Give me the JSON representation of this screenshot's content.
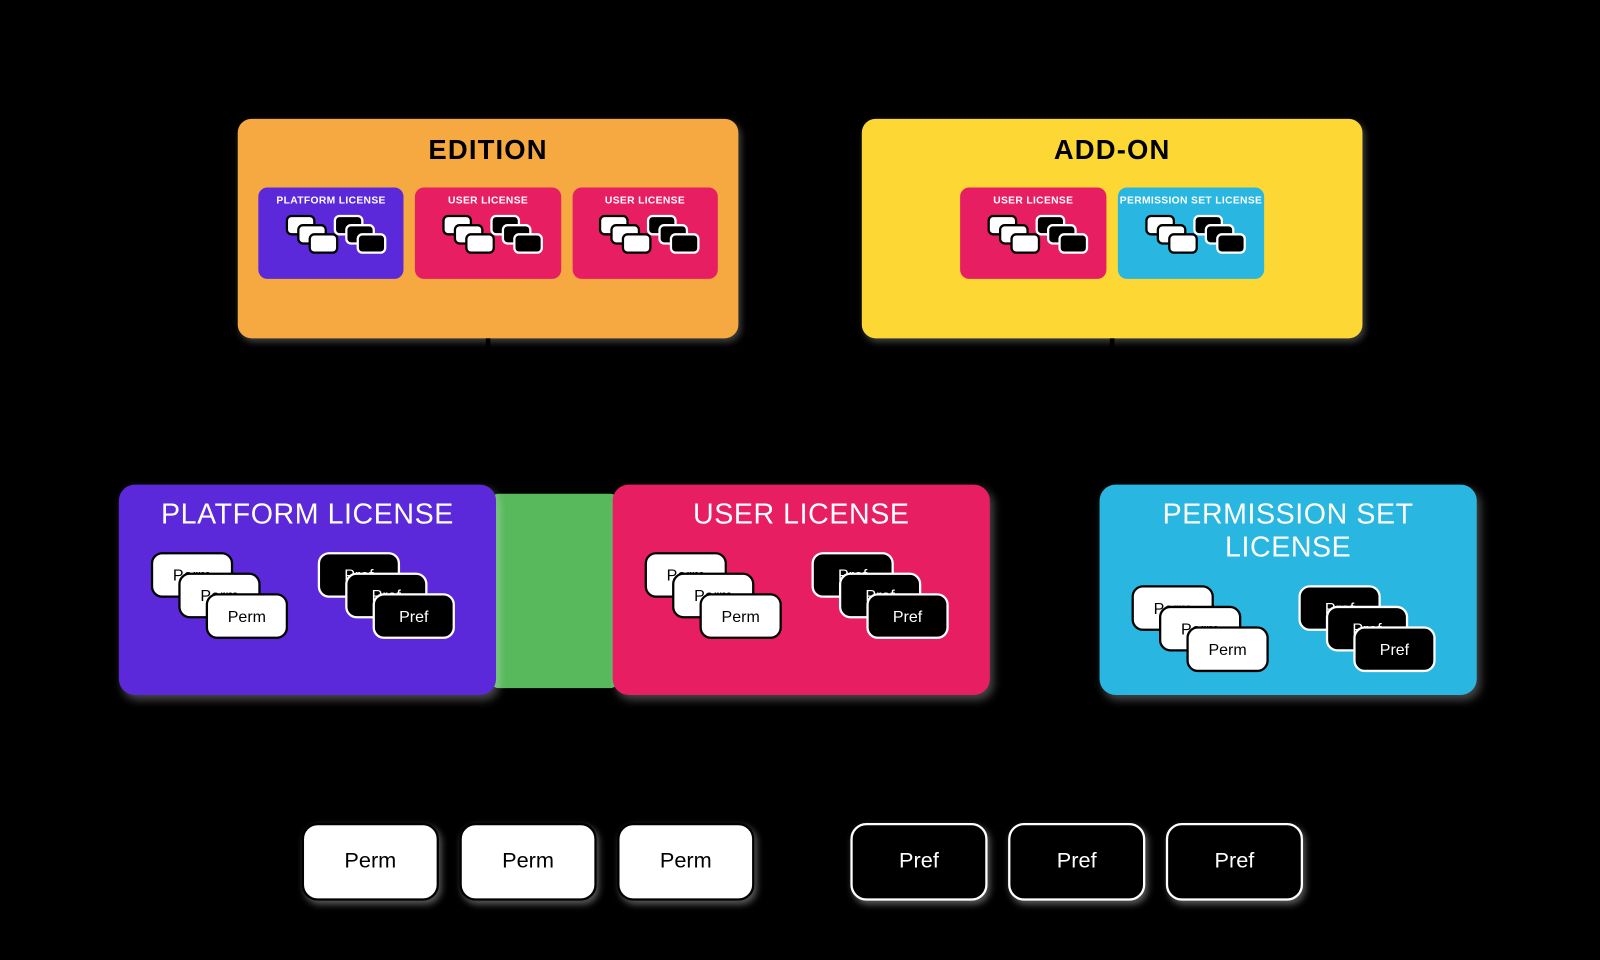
{
  "packaging": {
    "edition": {
      "title": "EDITION",
      "minis": [
        {
          "kind": "platform",
          "label": "PLATFORM LICENSE"
        },
        {
          "kind": "user",
          "label": "USER LICENSE"
        },
        {
          "kind": "user",
          "label": "USER LICENSE"
        }
      ]
    },
    "addon": {
      "title": "ADD-ON",
      "minis": [
        {
          "kind": "user",
          "label": "USER LICENSE"
        },
        {
          "kind": "psl",
          "label": "PERMISSION SET LICENSE"
        }
      ]
    }
  },
  "licenses": {
    "platform": {
      "title": "PLATFORM LICENSE",
      "perm_label": "Perm",
      "pref_label": "Pref"
    },
    "user": {
      "title": "USER LICENSE",
      "perm_label": "Perm",
      "pref_label": "Pref"
    },
    "psl": {
      "title": "PERMISSION SET LICENSE",
      "perm_label": "Perm",
      "pref_label": "Pref"
    }
  },
  "atoms": {
    "perm": "Perm",
    "pref": "Pref"
  },
  "colors": {
    "edition": "#f5a940",
    "addon": "#fdd835",
    "platform": "#5b29d9",
    "user": "#e81e63",
    "psl": "#29b6e0",
    "bridge": "#57b85c"
  }
}
